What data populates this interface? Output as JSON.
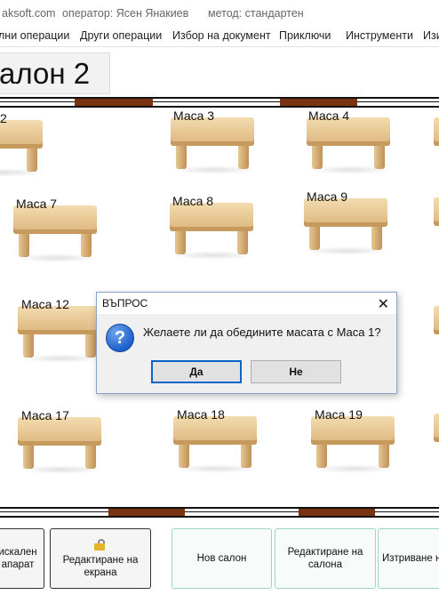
{
  "titlebar": {
    "site": "aksoft.com",
    "operator": "оператор: Ясен Янакиев",
    "method": "метод: стандартен"
  },
  "menu": [
    "лни операции",
    "Други операции",
    "Избор на документ",
    "Приключи",
    "Инструменти",
    "Изи"
  ],
  "salon": {
    "title": "алон 2"
  },
  "tables": [
    "2",
    "Маса 3",
    "Маса 4",
    "Маса 7",
    "Маса 8",
    "Маса 9",
    "Маса 12",
    "Маса 17",
    "Маса 18",
    "Маса 19"
  ],
  "dialog": {
    "title": "ВЪПРОС",
    "close": "✕",
    "icon": "question-icon",
    "message": "Желаете ли да обедините масата с Маса 1?",
    "yes": "Да",
    "no": "Не"
  },
  "bottom_buttons": {
    "fiscal_line1": "искален",
    "fiscal_line2": "апарат",
    "edit_screen_line1": "Редактиране на",
    "edit_screen_line2": "екрана",
    "new_salon": "Нов салон",
    "edit_salon_line1": "Редактиране на",
    "edit_salon_line2": "салона",
    "delete_salon": "Изтриване н"
  },
  "colors": {
    "door": "#7a3310",
    "accent_green": "#9ad7c0",
    "dialog_default_border": "#0a64c8"
  }
}
